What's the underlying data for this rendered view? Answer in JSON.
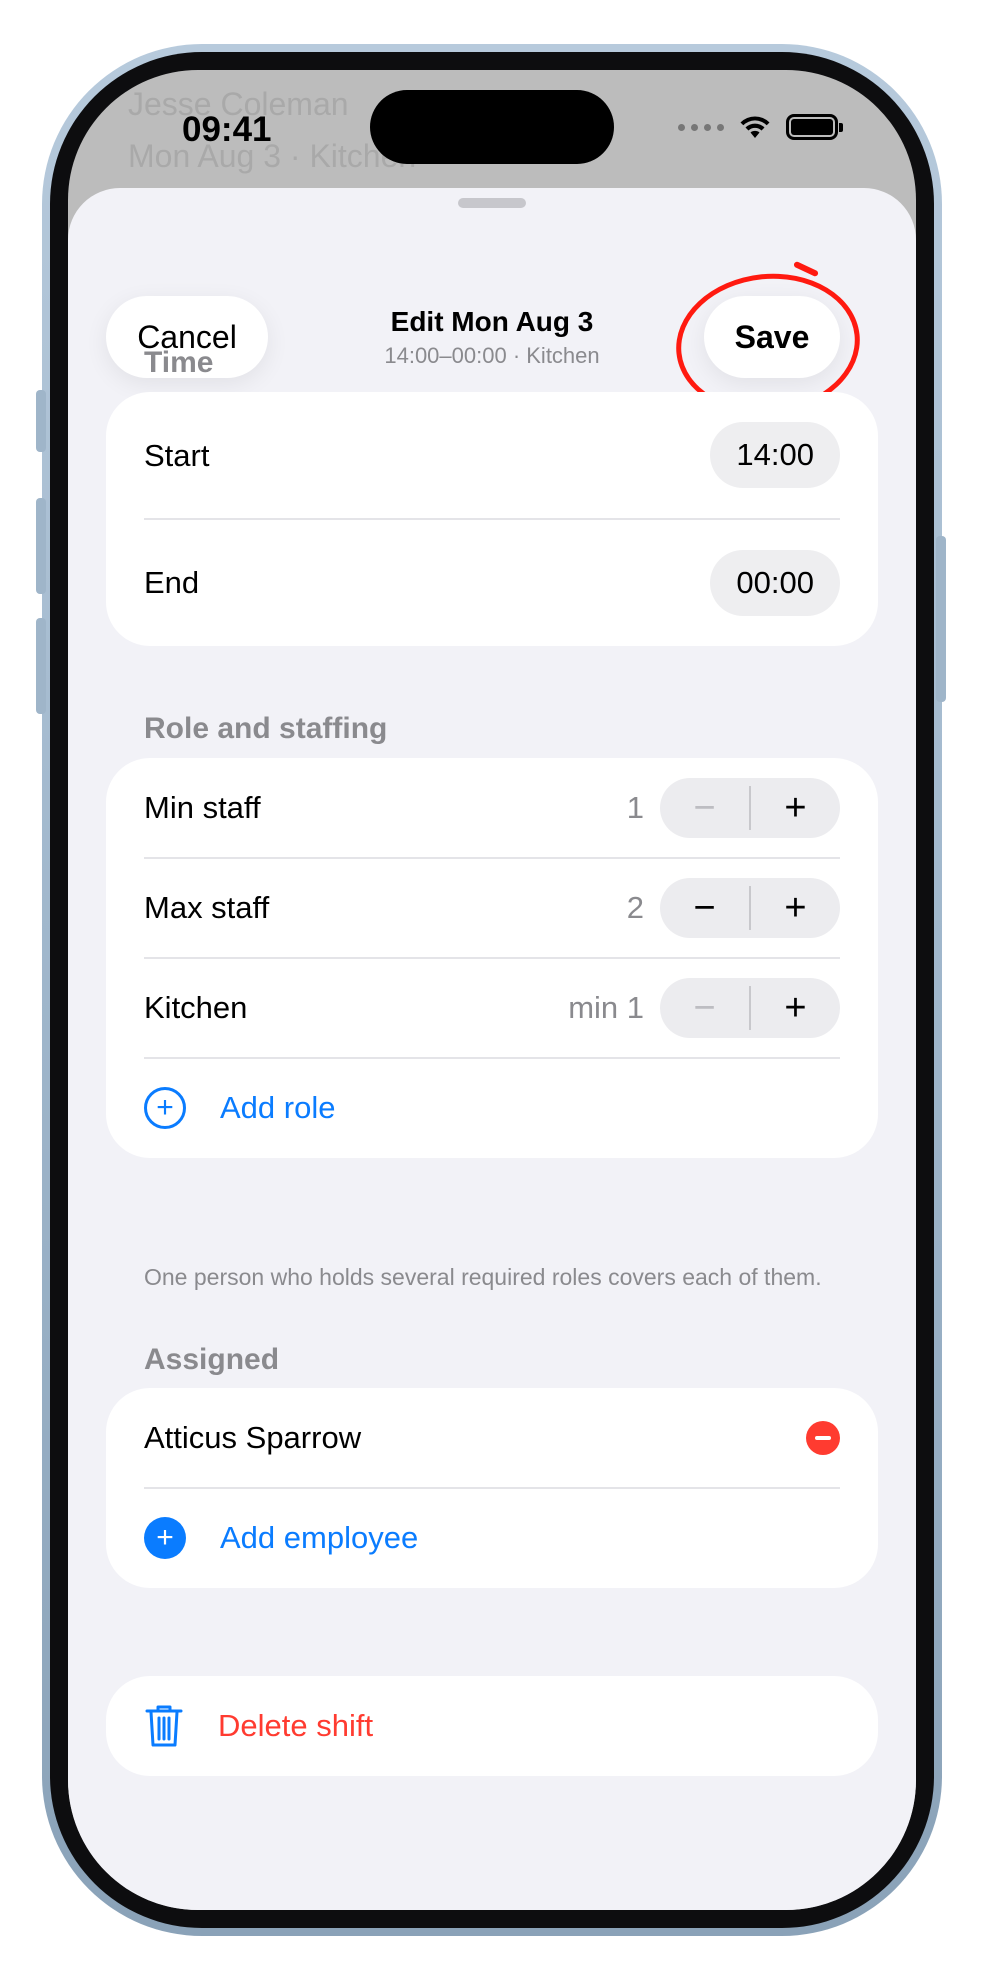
{
  "status_bar": {
    "time": "09:41"
  },
  "background": {
    "name_line_1": "Jesse Coleman",
    "name_line_2": "Mon Aug 3 · Kitchen"
  },
  "nav": {
    "cancel_label": "Cancel",
    "save_label": "Save",
    "title": "Edit Mon Aug 3",
    "subtitle": "14:00–00:00 · Kitchen"
  },
  "time_section": {
    "header": "Time",
    "start_label": "Start",
    "start_value": "14:00",
    "end_label": "End",
    "end_value": "00:00"
  },
  "staffing_section": {
    "header": "Role and staffing",
    "rows": [
      {
        "label": "Min staff",
        "value": "1",
        "minus_enabled": false
      },
      {
        "label": "Max staff",
        "value": "2",
        "minus_enabled": true
      },
      {
        "label": "Kitchen",
        "value": "min 1",
        "minus_enabled": false
      }
    ],
    "minus_symbol": "−",
    "plus_symbol": "+",
    "add_role_label": "Add role",
    "footnote": "One person who holds several required roles covers each of them."
  },
  "assigned_section": {
    "header": "Assigned",
    "employees": [
      "Atticus Sparrow"
    ],
    "add_employee_label": "Add employee"
  },
  "delete": {
    "label": "Delete shift"
  },
  "colors": {
    "accent": "#0a7cff",
    "destructive": "#ff3b30",
    "annotation": "#ff1a10",
    "sheet_background": "#f2f2f7"
  },
  "icons": {
    "add_role": "plus-circle-outline-icon",
    "add_employee": "plus-circle-filled-icon",
    "remove_employee": "minus-circle-filled-icon",
    "delete": "trash-icon",
    "wifi": "wifi-icon",
    "battery": "battery-icon"
  }
}
